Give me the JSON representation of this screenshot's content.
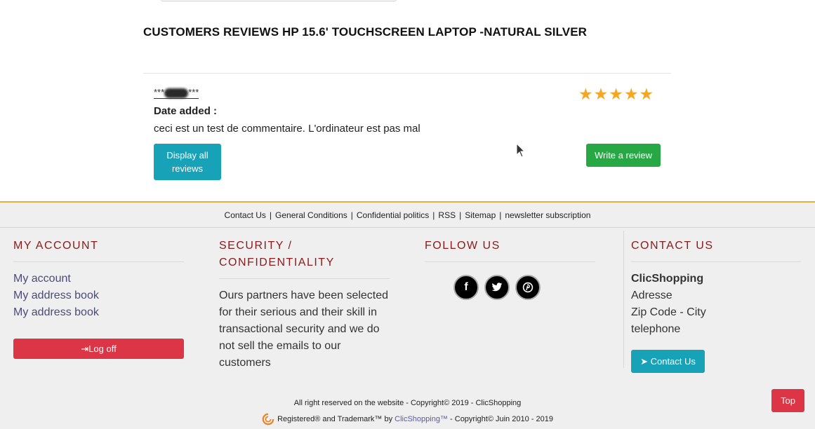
{
  "review": {
    "title": "CUSTOMERS REVIEWS HP 15.6' TOUCHSCREEN LAPTOP -NATURAL SILVER",
    "reviewer_prefix": "***",
    "reviewer_suffix": "***",
    "rating": 5,
    "rating_max": 5,
    "star_color": "#f5a623",
    "date_label": "Date added :",
    "comment": "ceci est un test de commentaire. L'ordinateur est pas mal",
    "display_all_label": "Display all reviews",
    "write_review_label": "Write a review"
  },
  "footer": {
    "links": [
      "Contact Us",
      "General Conditions",
      "Confidential politics",
      "RSS",
      "Sitemap",
      "newsletter subscription"
    ],
    "separator": "|",
    "my_account": {
      "title": "MY ACCOUNT",
      "links": [
        "My account",
        "My address book",
        "My address book"
      ],
      "logoff_label": "Log off"
    },
    "security": {
      "title": "SECURITY / CONFIDENTIALITY",
      "text": "Ours partners have been selected for their serious and their skill in transactional security and we do not sell the emails to our customers"
    },
    "follow": {
      "title": "FOLLOW US",
      "icons": [
        "facebook-icon",
        "twitter-icon",
        "pinterest-icon"
      ]
    },
    "contact": {
      "title": "CONTACT US",
      "company": "ClicShopping",
      "address": "Adresse",
      "zip_city": "Zip Code - City",
      "phone": "telephone",
      "button_label": "Contact Us"
    },
    "copyright_line1": "All right reserved on the website - Copyright© 2019 - ClicShopping",
    "copyright_prefix": "Registered® and Trademark™ by ",
    "copyright_brand": "ClicShopping™",
    "copyright_suffix": " - Copyright© Juin 2010 - 2019",
    "top_label": "Top",
    "accent_color": "#e0b23a",
    "title_color": "#8b1a1a"
  }
}
